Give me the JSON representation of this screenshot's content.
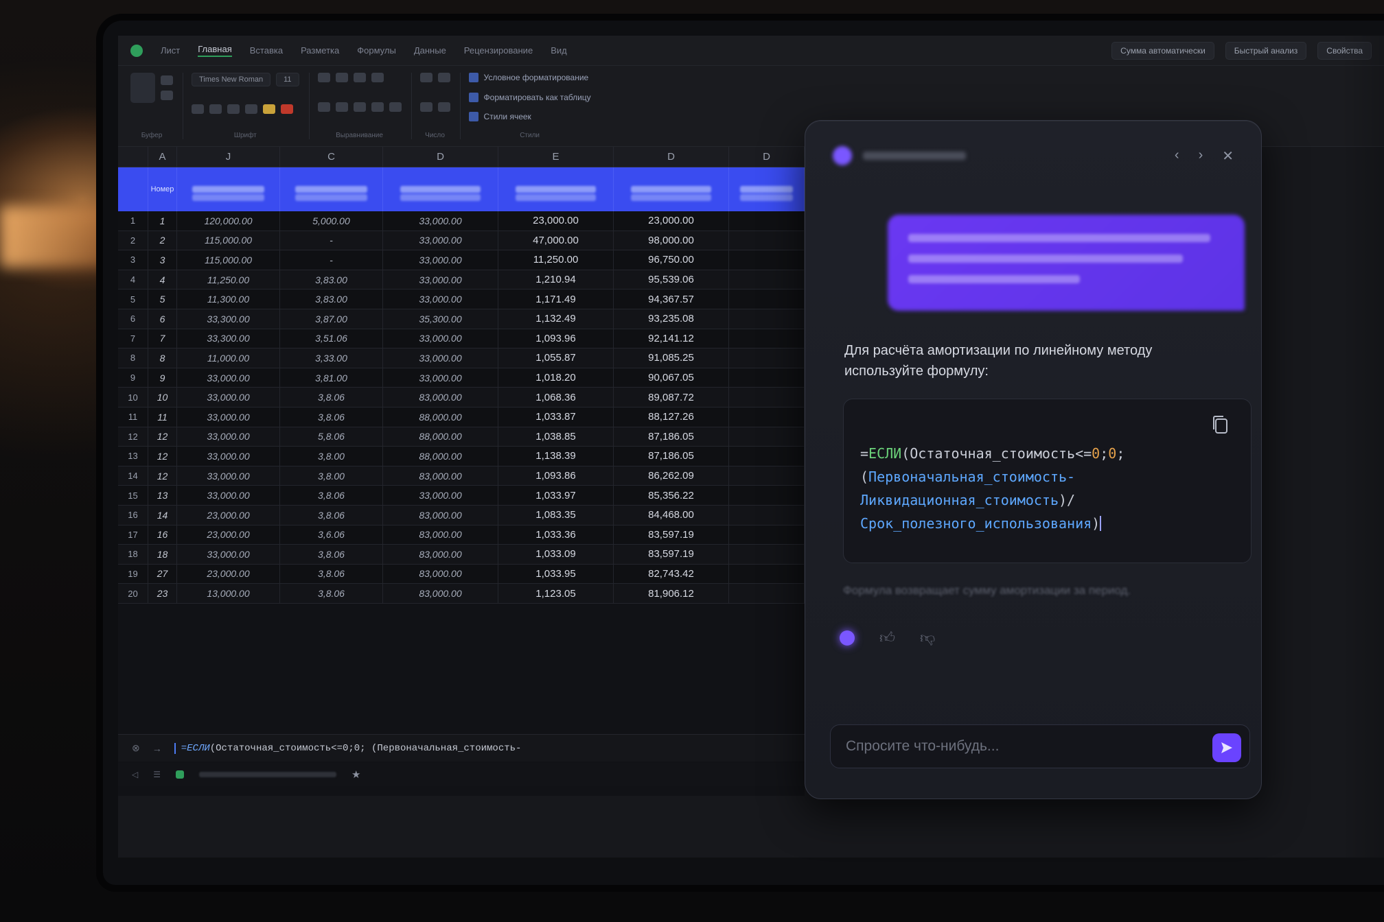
{
  "app": {
    "menu": [
      "Лист",
      "Главная",
      "Вставка",
      "Разметка",
      "Формулы",
      "Данные",
      "Рецензирование",
      "Вид"
    ],
    "active_menu_index": 1,
    "title_buttons": [
      "Сумма автоматически",
      "Быстрый анализ",
      "Свойства"
    ]
  },
  "ribbon": {
    "font_name": "Times New Roman",
    "font_size": "11",
    "links": [
      "Условное форматирование",
      "Форматировать как таблицу",
      "Стили ячеек"
    ],
    "captions": [
      "Буфер",
      "Шрифт",
      "Выравнивание",
      "Число",
      "Стили"
    ]
  },
  "sheet": {
    "columns": [
      "A",
      "J",
      "C",
      "D",
      "E",
      "D",
      "D"
    ],
    "first_header_label": "Номер",
    "rows": [
      {
        "n": "1",
        "idx": "1",
        "j": "120,000.00",
        "c": "5,000.00",
        "d": "33,000.00",
        "e": "23,000.00",
        "f": "23,000.00"
      },
      {
        "n": "2",
        "idx": "2",
        "j": "115,000.00",
        "c": "-",
        "d": "33,000.00",
        "e": "47,000.00",
        "f": "98,000.00"
      },
      {
        "n": "3",
        "idx": "3",
        "j": "115,000.00",
        "c": "-",
        "d": "33,000.00",
        "e": "11,250.00",
        "f": "96,750.00"
      },
      {
        "n": "4",
        "idx": "4",
        "j": "11,250.00",
        "c": "3,83.00",
        "d": "33,000.00",
        "e": "1,210.94",
        "f": "95,539.06"
      },
      {
        "n": "5",
        "idx": "5",
        "j": "11,300.00",
        "c": "3,83.00",
        "d": "33,000.00",
        "e": "1,171.49",
        "f": "94,367.57"
      },
      {
        "n": "6",
        "idx": "6",
        "j": "33,300.00",
        "c": "3,87.00",
        "d": "35,300.00",
        "e": "1,132.49",
        "f": "93,235.08"
      },
      {
        "n": "7",
        "idx": "7",
        "j": "33,300.00",
        "c": "3,51.06",
        "d": "33,000.00",
        "e": "1,093.96",
        "f": "92,141.12"
      },
      {
        "n": "8",
        "idx": "8",
        "j": "11,000.00",
        "c": "3,33.00",
        "d": "33,000.00",
        "e": "1,055.87",
        "f": "91,085.25"
      },
      {
        "n": "9",
        "idx": "9",
        "j": "33,000.00",
        "c": "3,81.00",
        "d": "33,000.00",
        "e": "1,018.20",
        "f": "90,067.05"
      },
      {
        "n": "10",
        "idx": "10",
        "j": "33,000.00",
        "c": "3,8.06",
        "d": "83,000.00",
        "e": "1,068.36",
        "f": "89,087.72"
      },
      {
        "n": "11",
        "idx": "11",
        "j": "33,000.00",
        "c": "3,8.06",
        "d": "88,000.00",
        "e": "1,033.87",
        "f": "88,127.26"
      },
      {
        "n": "12",
        "idx": "12",
        "j": "33,000.00",
        "c": "5,8.06",
        "d": "88,000.00",
        "e": "1,038.85",
        "f": "87,186.05"
      },
      {
        "n": "13",
        "idx": "12",
        "j": "33,000.00",
        "c": "3,8.00",
        "d": "88,000.00",
        "e": "1,138.39",
        "f": "87,186.05"
      },
      {
        "n": "14",
        "idx": "12",
        "j": "33,000.00",
        "c": "3,8.00",
        "d": "83,000.00",
        "e": "1,093.86",
        "f": "86,262.09"
      },
      {
        "n": "15",
        "idx": "13",
        "j": "33,000.00",
        "c": "3,8.06",
        "d": "33,000.00",
        "e": "1,033.97",
        "f": "85,356.22"
      },
      {
        "n": "16",
        "idx": "14",
        "j": "23,000.00",
        "c": "3,8.06",
        "d": "83,000.00",
        "e": "1,083.35",
        "f": "84,468.00"
      },
      {
        "n": "17",
        "idx": "16",
        "j": "23,000.00",
        "c": "3,6.06",
        "d": "83,000.00",
        "e": "1,033.36",
        "f": "83,597.19"
      },
      {
        "n": "18",
        "idx": "18",
        "j": "33,000.00",
        "c": "3,8.06",
        "d": "83,000.00",
        "e": "1,033.09",
        "f": "83,597.19"
      },
      {
        "n": "19",
        "idx": "27",
        "j": "23,000.00",
        "c": "3,8.06",
        "d": "83,000.00",
        "e": "1,033.95",
        "f": "82,743.42"
      },
      {
        "n": "20",
        "idx": "23",
        "j": "13,000.00",
        "c": "3,8.06",
        "d": "83,000.00",
        "e": "1,123.05",
        "f": "81,906.12"
      }
    ]
  },
  "formula_bar": {
    "fn": "=ЕСЛИ",
    "rest": "(Остаточная_стоимость<=0;0; (Первоначальная_стоимость-"
  },
  "assistant": {
    "answer_line1": "Для расчёта амортизации по линейному методу",
    "answer_line2": "используйте формулу:",
    "code": {
      "l1_prefix": "=",
      "l1_fn": "ЕСЛИ",
      "l1_open": "(Остаточная_стоимость<=",
      "l1_zero_a": "0",
      "l1_sep": ";",
      "l1_zero_b": "0",
      "l1_end": ";",
      "l2_open": "(",
      "l2_ref": "Первоначальная_стоимость-",
      "l3_ref": "Ликвидационная_стоимость",
      "l3_end": ")/",
      "l4_ref": "Срок_полезного_использования",
      "l4_end": ")"
    },
    "footnote": "Формула возвращает сумму амортизации за период.",
    "input_placeholder": "Спросите что-нибудь..."
  },
  "colors": {
    "accent": "#6a43ff",
    "header_blue": "#3a4cf0",
    "code_fn": "#6bd27a",
    "code_num": "#e5a14b",
    "code_ref": "#5ea8ff"
  }
}
